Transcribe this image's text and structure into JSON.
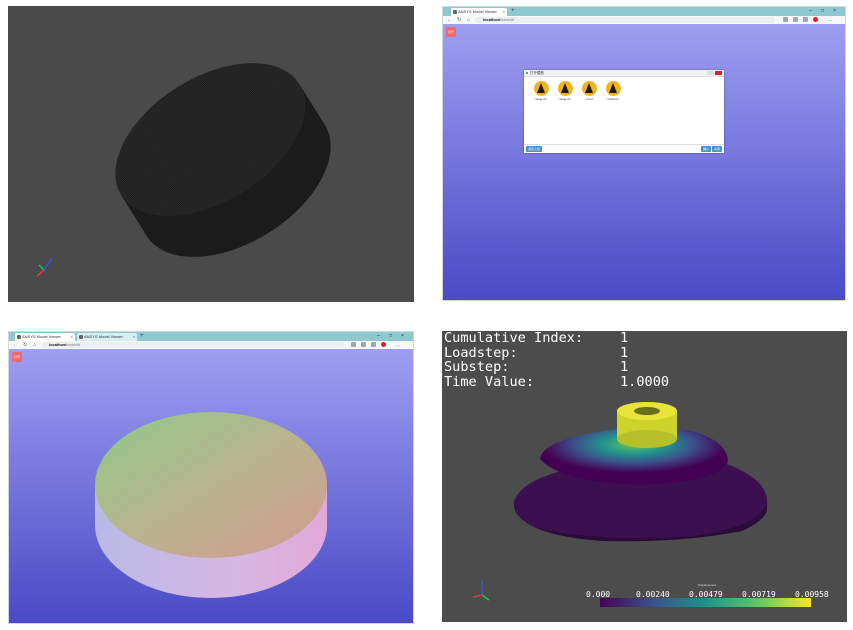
{
  "browser": {
    "tab_title": "ANSYS Model Viewer",
    "tab2_title": "ANSYS Model Viewer",
    "url_host": "localhost",
    "url_rest": ":xxxx/#/",
    "red_button_label": "打开"
  },
  "dialog": {
    "title": "打开模型",
    "files": [
      {
        "name": "large.rst",
        "icon": "ansys-logo-icon"
      },
      {
        "name": "large.rst",
        "icon": "ansys-logo-icon"
      },
      {
        "name": "ori.rst",
        "icon": "ansys-logo-icon"
      },
      {
        "name": "small.rst",
        "icon": "ansys-logo-icon"
      }
    ],
    "left_button": "返回上级",
    "ok_button": "确认",
    "cancel_button": "关闭"
  },
  "results": {
    "cumulative_index_label": "Cumulative Index:",
    "cumulative_index_value": "1",
    "loadstep_label": "Loadstep:",
    "loadstep_value": "1",
    "substep_label": "Substep:",
    "substep_value": "1",
    "time_value_label": "Time Value:",
    "time_value_value": "1.0000",
    "colorbar_title": "Displacement",
    "colorbar_ticks": [
      "0.000",
      "0.00240",
      "0.00479",
      "0.00719",
      "0.00958"
    ],
    "colormap": [
      "#440154",
      "#3b528b",
      "#21918c",
      "#5ec962",
      "#fde725"
    ]
  },
  "colors": {
    "viewer_background": "#4a4a4a",
    "gradient_top": "#9e9ef2",
    "gradient_bottom": "#4a4ac6",
    "tabbar": "#8ec9cf"
  }
}
